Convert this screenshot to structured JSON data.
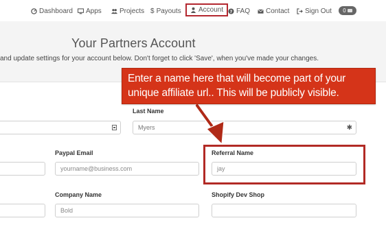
{
  "nav": {
    "items": [
      {
        "label": "Dashboard",
        "icon": "dashboard-icon"
      },
      {
        "label": "Apps",
        "icon": "monitor-icon"
      },
      {
        "label": "Projects",
        "icon": "users-icon"
      },
      {
        "label": "Payouts",
        "icon": "dollar-icon"
      },
      {
        "label": "Account",
        "icon": "user-icon",
        "active": true
      },
      {
        "label": "FAQ",
        "icon": "question-icon"
      },
      {
        "label": "Contact",
        "icon": "envelope-icon"
      },
      {
        "label": "Sign Out",
        "icon": "signout-icon"
      }
    ],
    "badge_count": "0"
  },
  "hero": {
    "title": "Your Partners Account",
    "description": "and update settings for your account below. Don't forget to click 'Save', when you've made your changes."
  },
  "callout": {
    "line1": "Enter a name here that will become part of your",
    "line2": "unique affiliate url.. This will be publicly visible."
  },
  "form": {
    "last_name_label": "Last Name",
    "last_name_value": "Myers",
    "paypal_email_label": "Paypal Email",
    "paypal_email_placeholder": "yourname@business.com",
    "referral_name_label": "Referral Name",
    "referral_name_value": "jay",
    "company_name_label": "Company Name",
    "company_name_value": "Bold",
    "shopify_dev_shop_label": "Shopify Dev Shop"
  },
  "colors": {
    "callout_bg": "#d53419",
    "highlight_border": "#b22a25",
    "active_nav_border": "#b3272f"
  }
}
